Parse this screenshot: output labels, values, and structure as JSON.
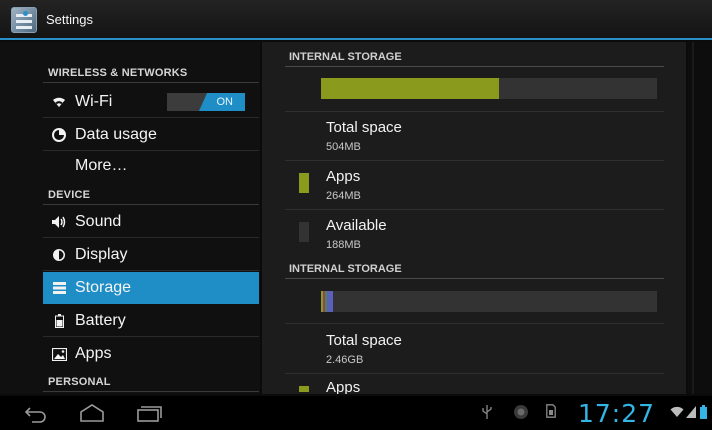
{
  "actionbar": {
    "title": "Settings",
    "icon": "settings-app-icon"
  },
  "sidebar": {
    "categories": [
      "WIRELESS & NETWORKS",
      "DEVICE",
      "PERSONAL"
    ],
    "items": [
      {
        "label": "Wi-Fi",
        "icon": "wifi-icon",
        "toggle": "ON"
      },
      {
        "label": "Data usage",
        "icon": "data-usage-icon"
      },
      {
        "label": "More…"
      },
      {
        "label": "Sound",
        "icon": "speaker-icon"
      },
      {
        "label": "Display",
        "icon": "brightness-icon"
      },
      {
        "label": "Storage",
        "icon": "storage-icon",
        "selected": true
      },
      {
        "label": "Battery",
        "icon": "battery-icon"
      },
      {
        "label": "Apps",
        "icon": "apps-icon"
      }
    ]
  },
  "storage": {
    "sections": [
      {
        "header": "INTERNAL STORAGE",
        "usage_fraction_apps": 0.53,
        "total_label": "Total space",
        "total_value": "504MB",
        "apps_label": "Apps",
        "apps_value": "264MB",
        "available_label": "Available",
        "available_value": "188MB"
      },
      {
        "header": "INTERNAL STORAGE",
        "usage_segments": [
          {
            "color": "#8a9a1c",
            "fraction": 0.006
          },
          {
            "color": "#9a3c6a",
            "fraction": 0.006
          },
          {
            "color": "#4b8a3c",
            "fraction": 0.006
          },
          {
            "color": "#5b5fc0",
            "fraction": 0.018
          }
        ],
        "total_label": "Total space",
        "total_value": "2.46GB",
        "apps_label": "Apps"
      }
    ],
    "colors": {
      "apps": "#8a9a1c",
      "available": "#333333",
      "accent": "#1f8ec6"
    }
  },
  "statusbar": {
    "clock": "17:27",
    "icons": [
      "usb-icon",
      "record-icon",
      "sdcard-icon",
      "wifi-signal-icon",
      "cell-signal-icon",
      "battery-icon"
    ]
  },
  "navbar": {
    "buttons": [
      "back-button",
      "home-button",
      "recent-apps-button"
    ]
  }
}
